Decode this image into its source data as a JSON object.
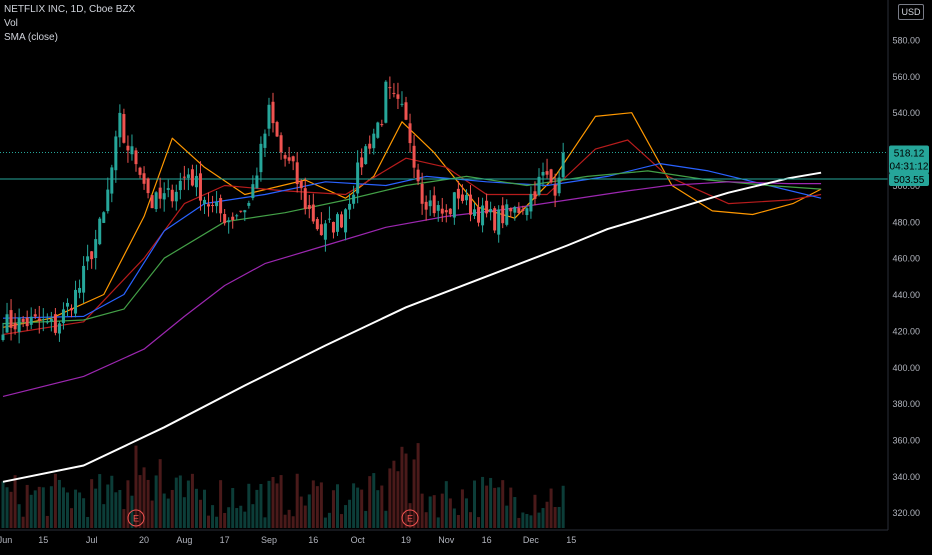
{
  "legend": {
    "symbol": "NETFLIX INC, 1D, Cboe BZX",
    "vol": "Vol",
    "sma": "SMA (close)"
  },
  "currency": "USD",
  "price_labels": {
    "last": "518.12",
    "countdown": "04:31:12",
    "line": "503.55"
  },
  "colors": {
    "up": "#26a69a",
    "down": "#ef5350",
    "ma_orange": "#ff9800",
    "ma_red": "#b71c1c",
    "ma_blue": "#2962ff",
    "ma_green": "#43a047",
    "ma_purple": "#9c27b0",
    "ma_white": "#ffffff",
    "hline": "#26a69a"
  },
  "chart_data": {
    "type": "candlestick",
    "y_axis": {
      "range": [
        316,
        602
      ],
      "ticks": [
        320,
        340,
        360,
        380,
        400,
        420,
        440,
        460,
        480,
        500,
        520,
        540,
        560,
        580
      ]
    },
    "x_axis": {
      "labels": [
        "Jun",
        "15",
        "Jul",
        "20",
        "Aug",
        "17",
        "Sep",
        "16",
        "Oct",
        "19",
        "Nov",
        "16",
        "Dec",
        "15"
      ]
    },
    "horizontal_line": 503.55,
    "last_price": 518.12,
    "earnings_markers": [
      "E",
      "E"
    ],
    "grid": false,
    "anchors": [
      {
        "x": "Jun 1",
        "price": 424
      },
      {
        "x": "Jun 12",
        "price": 425
      },
      {
        "x": "Jun 18",
        "price": 422
      },
      {
        "x": "Jun 26",
        "price": 444
      },
      {
        "x": "Jul 1",
        "price": 464
      },
      {
        "x": "Jul 6",
        "price": 483
      },
      {
        "x": "Jul 10",
        "price": 535
      },
      {
        "x": "Jul 13",
        "price": 525
      },
      {
        "x": "Jul 17",
        "price": 510
      },
      {
        "x": "Jul 22",
        "price": 490
      },
      {
        "x": "Jul 28",
        "price": 494
      },
      {
        "x": "Aug 4",
        "price": 507
      },
      {
        "x": "Aug 12",
        "price": 487
      },
      {
        "x": "Aug 18",
        "price": 482
      },
      {
        "x": "Aug 25",
        "price": 490
      },
      {
        "x": "Aug 28",
        "price": 518
      },
      {
        "x": "Sep 1",
        "price": 540
      },
      {
        "x": "Sep 4",
        "price": 518
      },
      {
        "x": "Sep 9",
        "price": 508
      },
      {
        "x": "Sep 14",
        "price": 490
      },
      {
        "x": "Sep 18",
        "price": 474
      },
      {
        "x": "Sep 25",
        "price": 482
      },
      {
        "x": "Sep 30",
        "price": 500
      },
      {
        "x": "Oct 5",
        "price": 520
      },
      {
        "x": "Oct 9",
        "price": 538
      },
      {
        "x": "Oct 12",
        "price": 552
      },
      {
        "x": "Oct 16",
        "price": 540
      },
      {
        "x": "Oct 20",
        "price": 526
      },
      {
        "x": "Oct 23",
        "price": 495
      },
      {
        "x": "Oct 28",
        "price": 488
      },
      {
        "x": "Nov 2",
        "price": 483
      },
      {
        "x": "Nov 5",
        "price": 496
      },
      {
        "x": "Nov 9",
        "price": 490
      },
      {
        "x": "Nov 13",
        "price": 484
      },
      {
        "x": "Nov 18",
        "price": 481
      },
      {
        "x": "Nov 25",
        "price": 486
      },
      {
        "x": "Nov 30",
        "price": 491
      },
      {
        "x": "Dec 4",
        "price": 505
      },
      {
        "x": "Dec 9",
        "price": 500
      },
      {
        "x": "Dec 11",
        "price": 518
      }
    ],
    "ma_approx": [
      {
        "color": "ma_orange",
        "points": [
          [
            0,
            422
          ],
          [
            12,
            427
          ],
          [
            25,
            440
          ],
          [
            35,
            483
          ],
          [
            42,
            526
          ],
          [
            50,
            510
          ],
          [
            60,
            495
          ],
          [
            75,
            503
          ],
          [
            85,
            493
          ],
          [
            92,
            505
          ],
          [
            99,
            535
          ],
          [
            107,
            518
          ],
          [
            118,
            488
          ],
          [
            127,
            482
          ],
          [
            137,
            505
          ],
          [
            147,
            538
          ],
          [
            156,
            540
          ],
          [
            166,
            500
          ],
          [
            176,
            486
          ],
          [
            186,
            484
          ],
          [
            196,
            490
          ],
          [
            203,
            498
          ]
        ]
      },
      {
        "color": "ma_red",
        "points": [
          [
            0,
            418
          ],
          [
            20,
            425
          ],
          [
            35,
            460
          ],
          [
            45,
            490
          ],
          [
            55,
            500
          ],
          [
            70,
            497
          ],
          [
            85,
            495
          ],
          [
            100,
            515
          ],
          [
            110,
            510
          ],
          [
            120,
            495
          ],
          [
            135,
            495
          ],
          [
            147,
            520
          ],
          [
            155,
            525
          ],
          [
            165,
            505
          ],
          [
            180,
            490
          ],
          [
            195,
            492
          ],
          [
            203,
            495
          ]
        ]
      },
      {
        "color": "ma_blue",
        "points": [
          [
            0,
            427
          ],
          [
            20,
            428
          ],
          [
            30,
            440
          ],
          [
            40,
            475
          ],
          [
            50,
            490
          ],
          [
            65,
            495
          ],
          [
            80,
            502
          ],
          [
            95,
            500
          ],
          [
            105,
            505
          ],
          [
            120,
            502
          ],
          [
            135,
            500
          ],
          [
            150,
            505
          ],
          [
            163,
            512
          ],
          [
            175,
            508
          ],
          [
            190,
            500
          ],
          [
            203,
            493
          ]
        ]
      },
      {
        "color": "ma_green",
        "points": [
          [
            0,
            424
          ],
          [
            20,
            426
          ],
          [
            30,
            432
          ],
          [
            40,
            460
          ],
          [
            55,
            480
          ],
          [
            70,
            485
          ],
          [
            85,
            492
          ],
          [
            100,
            500
          ],
          [
            115,
            505
          ],
          [
            130,
            500
          ],
          [
            145,
            505
          ],
          [
            160,
            508
          ],
          [
            175,
            503
          ],
          [
            190,
            500
          ],
          [
            203,
            498
          ]
        ]
      },
      {
        "color": "ma_purple",
        "points": [
          [
            0,
            384
          ],
          [
            20,
            395
          ],
          [
            35,
            410
          ],
          [
            45,
            428
          ],
          [
            55,
            445
          ],
          [
            65,
            457
          ],
          [
            80,
            467
          ],
          [
            95,
            477
          ],
          [
            110,
            483
          ],
          [
            125,
            487
          ],
          [
            140,
            492
          ],
          [
            155,
            497
          ],
          [
            165,
            500
          ],
          [
            180,
            502
          ],
          [
            195,
            501
          ],
          [
            203,
            501
          ]
        ]
      },
      {
        "color": "ma_white",
        "points": [
          [
            0,
            337
          ],
          [
            20,
            346
          ],
          [
            40,
            367
          ],
          [
            60,
            390
          ],
          [
            80,
            412
          ],
          [
            100,
            433
          ],
          [
            120,
            450
          ],
          [
            140,
            467
          ],
          [
            150,
            476
          ],
          [
            165,
            486
          ],
          [
            180,
            496
          ],
          [
            195,
            504
          ],
          [
            203,
            507
          ]
        ]
      }
    ]
  }
}
